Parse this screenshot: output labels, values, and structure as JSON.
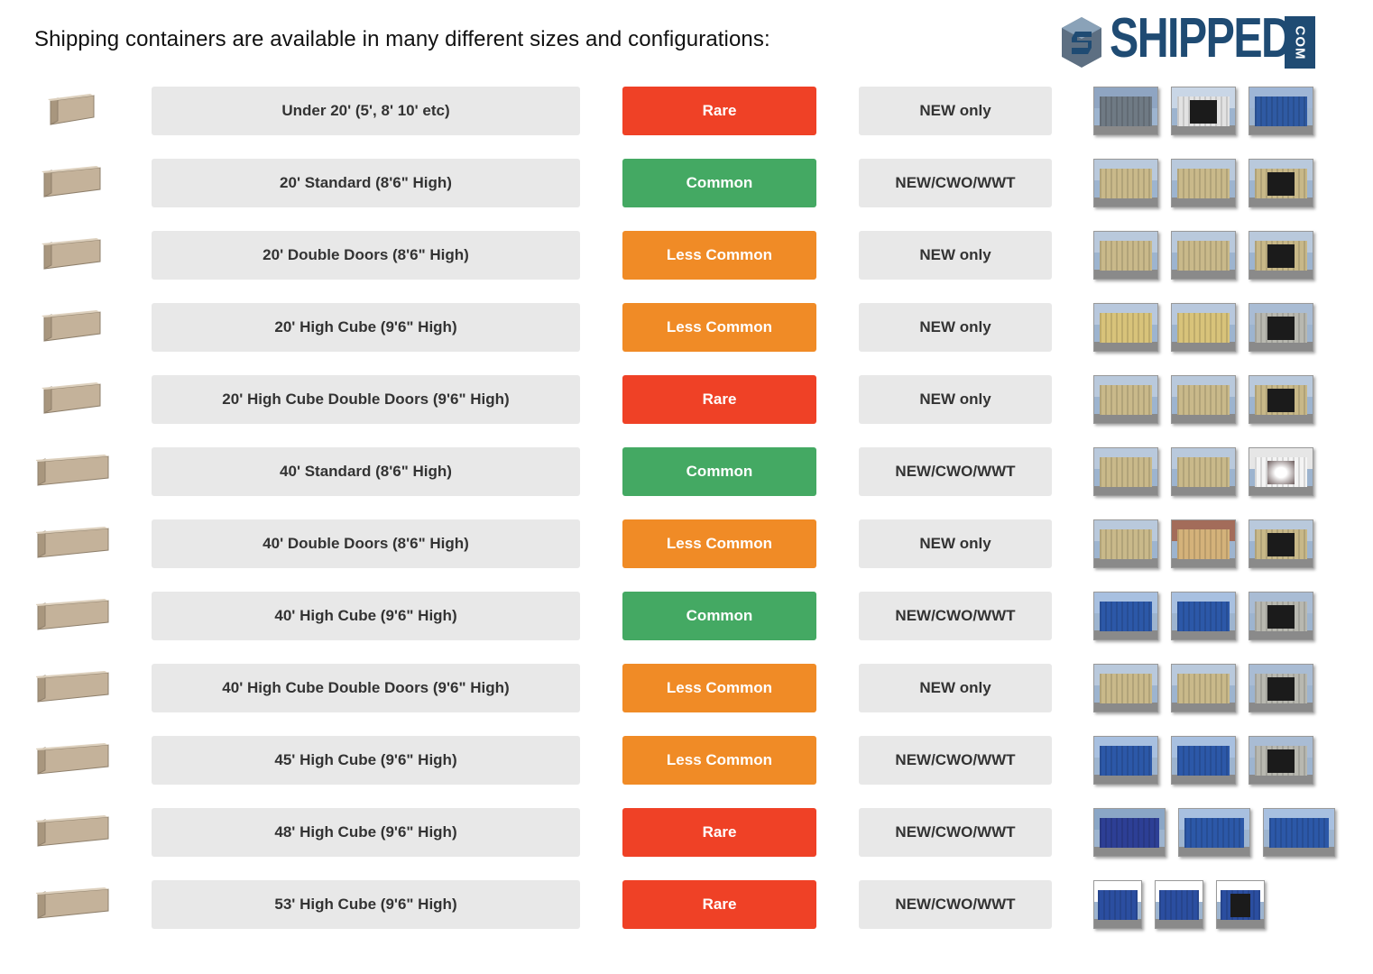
{
  "heading": "Shipping containers are available in many different sizes and configurations:",
  "logo": {
    "text": "SHIPPED",
    "suffix": "COM",
    "color": "#1f4b73"
  },
  "colors": {
    "Rare": "#ef4126",
    "Common": "#44a963",
    "Less Common": "#f08b26"
  },
  "rows": [
    {
      "size": "Under 20' (5', 8' 10' etc)",
      "availability": "Rare",
      "condition": "NEW only",
      "icon": "short-container-icon",
      "photos": [
        "grey-blue",
        "white-open",
        "blue-crane"
      ]
    },
    {
      "size": "20' Standard (8'6\" High)",
      "availability": "Common",
      "condition": "NEW/CWO/WWT",
      "icon": "20ft-container-icon",
      "photos": [
        "tan",
        "tan",
        "tan-open"
      ]
    },
    {
      "size": "20' Double Doors (8'6\" High)",
      "availability": "Less Common",
      "condition": "NEW only",
      "icon": "20ft-container-icon",
      "photos": [
        "tan",
        "tan",
        "tan-open"
      ]
    },
    {
      "size": "20' High Cube (9'6\" High)",
      "availability": "Less Common",
      "condition": "NEW only",
      "icon": "20ft-container-icon",
      "photos": [
        "yellow",
        "yellow",
        "grey-open"
      ]
    },
    {
      "size": "20' High Cube Double Doors (9'6\" High)",
      "availability": "Rare",
      "condition": "NEW only",
      "icon": "20ft-container-icon",
      "photos": [
        "tan",
        "tan",
        "tan-open"
      ]
    },
    {
      "size": "40' Standard (8'6\" High)",
      "availability": "Common",
      "condition": "NEW/CWO/WWT",
      "icon": "40ft-container-icon",
      "photos": [
        "tan",
        "tan",
        "white-interior"
      ]
    },
    {
      "size": "40' Double Doors (8'6\" High)",
      "availability": "Less Common",
      "condition": "NEW only",
      "icon": "40ft-container-icon",
      "photos": [
        "tan",
        "tan-red",
        "tan-open"
      ]
    },
    {
      "size": "40' High Cube (9'6\" High)",
      "availability": "Common",
      "condition": "NEW/CWO/WWT",
      "icon": "40ft-container-icon",
      "photos": [
        "blue",
        "blue",
        "grey-open"
      ]
    },
    {
      "size": "40' High Cube Double Doors (9'6\" High)",
      "availability": "Less Common",
      "condition": "NEW only",
      "icon": "40ft-container-icon",
      "photos": [
        "tan",
        "tan",
        "grey-open"
      ]
    },
    {
      "size": "45' High Cube (9'6\" High)",
      "availability": "Less Common",
      "condition": "NEW/CWO/WWT",
      "icon": "40ft-container-icon",
      "photos": [
        "blue",
        "blue",
        "grey-open"
      ]
    },
    {
      "size": "48' High Cube (9'6\" High)",
      "availability": "Rare",
      "condition": "NEW/CWO/WWT",
      "icon": "40ft-container-icon",
      "photos": [
        "blue-rail",
        "blue",
        "blue"
      ]
    },
    {
      "size": "53' High Cube (9'6\" High)",
      "availability": "Rare",
      "condition": "NEW/CWO/WWT",
      "icon": "40ft-container-icon",
      "photos": [
        "blue-white",
        "blue-white",
        "blue-white-open"
      ]
    }
  ]
}
